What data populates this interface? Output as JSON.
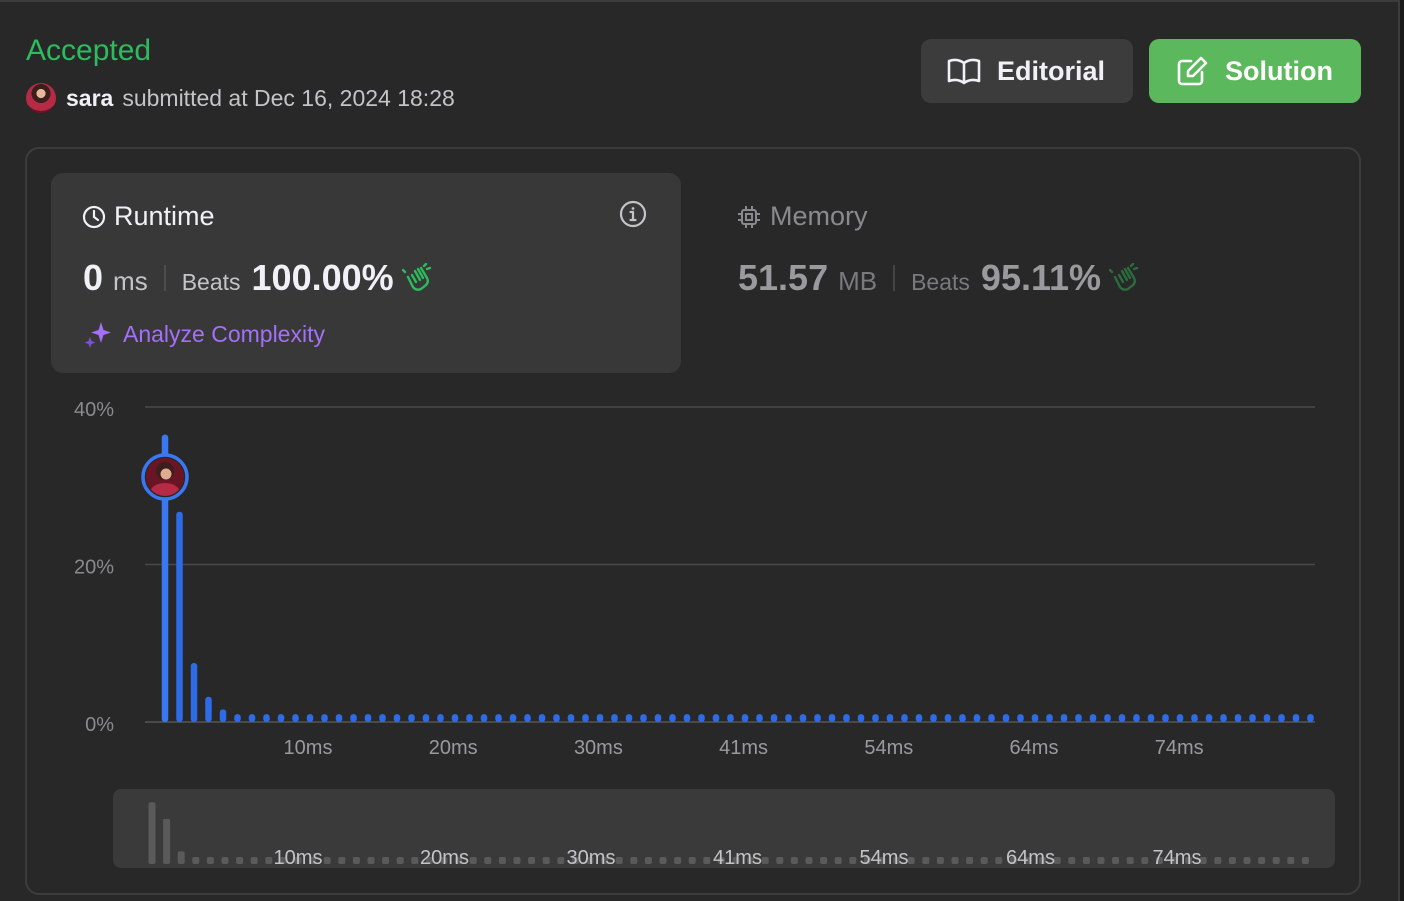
{
  "submission": {
    "status": "Accepted",
    "user": "sara",
    "submitted_text": "submitted at Dec 16, 2024 18:28"
  },
  "buttons": {
    "editorial": "Editorial",
    "solution": "Solution"
  },
  "runtime": {
    "title": "Runtime",
    "value": "0",
    "unit": "ms",
    "beats_label": "Beats",
    "beats_pct": "100.00%",
    "analyze": "Analyze Complexity"
  },
  "memory": {
    "title": "Memory",
    "value": "51.57",
    "unit": "MB",
    "beats_label": "Beats",
    "beats_pct": "95.11%"
  },
  "colors": {
    "accepted": "#2cbb5d",
    "solution_button": "#5cb85c",
    "bar": "#2e6be6",
    "analyze": "#a370f7"
  },
  "chart_data": {
    "type": "bar",
    "y_ticks": [
      "40%",
      "20%",
      "0%"
    ],
    "ylim": [
      0,
      40
    ],
    "x_tick_labels": [
      "10ms",
      "20ms",
      "30ms",
      "41ms",
      "54ms",
      "64ms",
      "74ms"
    ],
    "x_tick_bar_index": [
      5,
      10,
      15,
      20,
      25,
      30,
      35
    ],
    "num_bars": 80,
    "highlighted_bar_index": 0,
    "values": [
      36.5,
      26.7,
      7.5,
      3.2,
      1.6,
      1.0,
      1.0,
      1.0,
      1.0,
      1.0,
      1.0,
      1.0,
      1.0,
      1.0,
      1.0,
      1.0,
      1.0,
      1.0,
      1.0,
      1.0,
      1.0,
      1.0,
      1.0,
      1.0,
      1.0,
      1.0,
      1.0,
      1.0,
      1.0,
      1.0,
      1.0,
      1.0,
      1.0,
      1.0,
      1.0,
      1.0,
      1.0,
      1.0,
      1.0,
      1.0,
      1.0,
      1.0,
      1.0,
      1.0,
      1.0,
      1.0,
      1.0,
      1.0,
      1.0,
      1.0,
      1.0,
      1.0,
      1.0,
      1.0,
      1.0,
      1.0,
      1.0,
      1.0,
      1.0,
      1.0,
      1.0,
      1.0,
      1.0,
      1.0,
      1.0,
      1.0,
      1.0,
      1.0,
      1.0,
      1.0,
      1.0,
      1.0,
      1.0,
      1.0,
      1.0,
      1.0,
      1.0,
      1.0,
      1.0,
      1.0
    ]
  }
}
